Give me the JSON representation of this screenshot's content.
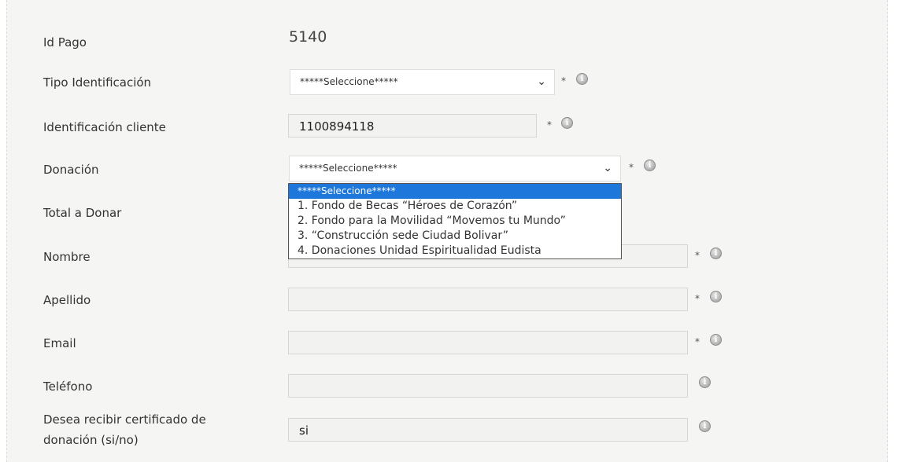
{
  "form": {
    "id_pago": {
      "label": "Id Pago",
      "value": "5140"
    },
    "tipo_identificacion": {
      "label": "Tipo Identificación",
      "selected": "*****Seleccione*****"
    },
    "identificacion_cliente": {
      "label": "Identificación cliente",
      "value": "1100894118"
    },
    "donacion": {
      "label": "Donación",
      "selected": "*****Seleccione*****"
    },
    "total_a_donar": {
      "label": "Total a Donar"
    },
    "nombre": {
      "label": "Nombre",
      "value": ""
    },
    "apellido": {
      "label": "Apellido",
      "value": ""
    },
    "email": {
      "label": "Email",
      "value": ""
    },
    "telefono": {
      "label": "Teléfono",
      "value": ""
    },
    "certificado": {
      "label_line1": "Desea recibir certificado de",
      "label_line2": "donación (si/no)",
      "value": "si"
    },
    "required_marker": "*",
    "info_icon": "info-circle-icon",
    "chevron_icon": "chevron-down-icon"
  },
  "donacion_dropdown": {
    "options": [
      "*****Seleccione*****",
      "1. Fondo de Becas “Héroes de Corazón”",
      "2. Fondo para la Movilidad “Movemos tu Mundo”",
      "3. “Construcción sede Ciudad Bolivar”",
      "4. Donaciones Unidad Espiritualidad Eudista"
    ],
    "highlighted_index": 0
  },
  "colors": {
    "panel_bg": "#f5f5f3",
    "field_bg": "#f2f2f0",
    "highlight": "#1e78dc"
  }
}
